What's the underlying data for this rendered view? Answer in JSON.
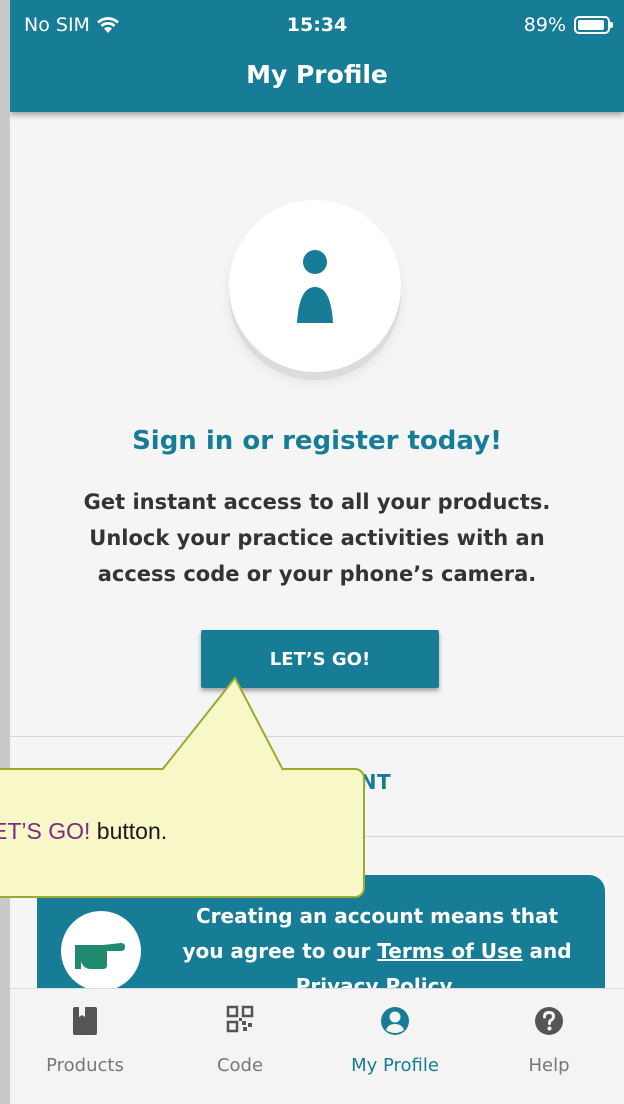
{
  "status_bar": {
    "carrier": "No SIM",
    "time": "15:34",
    "battery": "89%"
  },
  "header": {
    "title": "My Profile"
  },
  "profile": {
    "heading": "Sign in or register today!",
    "description_lines": [
      "Get instant access to all your products.",
      "Unlock your practice activities with an",
      "access code or your phone’s camera."
    ],
    "button_label": "LET’S GO!"
  },
  "section": {
    "label": "ED CONTENT"
  },
  "card": {
    "line1": "Creating an account means that",
    "line2_prefix": "you agree to our ",
    "terms_link": "Terms of Use",
    "line2_suffix": " and",
    "privacy_link": "Privacy Policy."
  },
  "callout": {
    "highlight": "ET’S GO!",
    "text": " button."
  },
  "tabs": [
    {
      "label": "Products",
      "icon": "book-icon",
      "active": false
    },
    {
      "label": "Code",
      "icon": "qr-code-icon",
      "active": false
    },
    {
      "label": "My Profile",
      "icon": "user-circle-icon",
      "active": true
    },
    {
      "label": "Help",
      "icon": "help-circle-icon",
      "active": false
    }
  ],
  "colors": {
    "primary": "#177c95",
    "callout_bg": "#f7f7c8",
    "callout_border": "#9aac2e",
    "highlight": "#7b2a86"
  }
}
